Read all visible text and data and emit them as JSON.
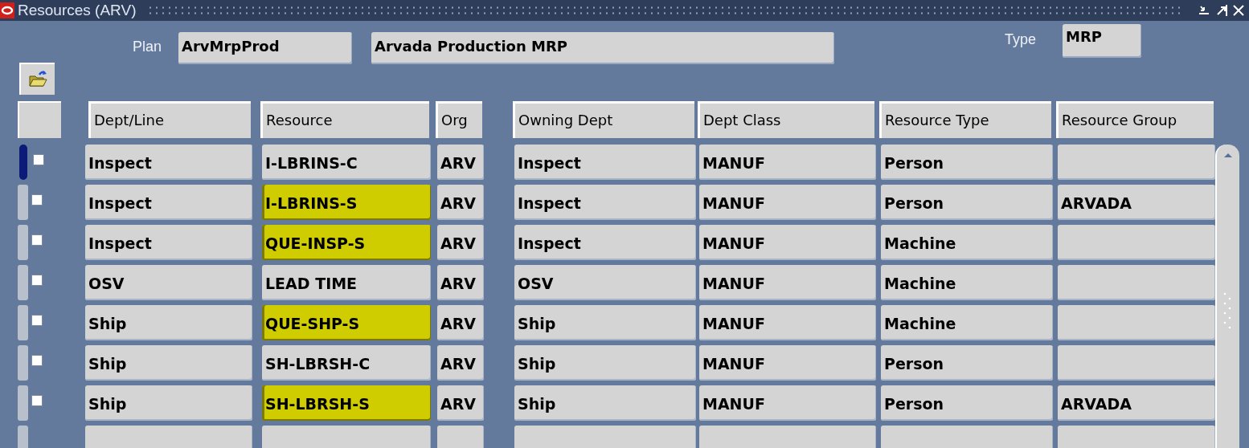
{
  "window": {
    "title": "Resources (ARV)"
  },
  "plan": {
    "label": "Plan",
    "code": "ArvMrpProd",
    "description": "Arvada Production MRP"
  },
  "type": {
    "label": "Type",
    "value": "MRP"
  },
  "table": {
    "columns": [
      "Dept/Line",
      "Resource",
      "Org",
      "Owning Dept",
      "Dept Class",
      "Resource Type",
      "Resource Group"
    ],
    "rows": [
      {
        "current": true,
        "checked": false,
        "highlighted": false,
        "cells": [
          "Inspect",
          "I-LBRINS-C",
          "ARV",
          "Inspect",
          "MANUF",
          "Person",
          null
        ]
      },
      {
        "current": false,
        "checked": false,
        "highlighted": true,
        "cells": [
          "Inspect",
          "I-LBRINS-S",
          "ARV",
          "Inspect",
          "MANUF",
          "Person",
          "ARVADA"
        ]
      },
      {
        "current": false,
        "checked": false,
        "highlighted": true,
        "cells": [
          "Inspect",
          "QUE-INSP-S",
          "ARV",
          "Inspect",
          "MANUF",
          "Machine",
          null
        ]
      },
      {
        "current": false,
        "checked": false,
        "highlighted": false,
        "cells": [
          "OSV",
          "LEAD TIME",
          "ARV",
          "OSV",
          "MANUF",
          "Machine",
          null
        ]
      },
      {
        "current": false,
        "checked": false,
        "highlighted": true,
        "cells": [
          "Ship",
          "QUE-SHP-S",
          "ARV",
          "Ship",
          "MANUF",
          "Machine",
          null
        ]
      },
      {
        "current": false,
        "checked": false,
        "highlighted": false,
        "cells": [
          "Ship",
          "SH-LBRSH-C",
          "ARV",
          "Ship",
          "MANUF",
          "Person",
          null
        ]
      },
      {
        "current": false,
        "checked": false,
        "highlighted": true,
        "cells": [
          "Ship",
          "SH-LBRSH-S",
          "ARV",
          "Ship",
          "MANUF",
          "Person",
          "ARVADA"
        ]
      }
    ]
  }
}
